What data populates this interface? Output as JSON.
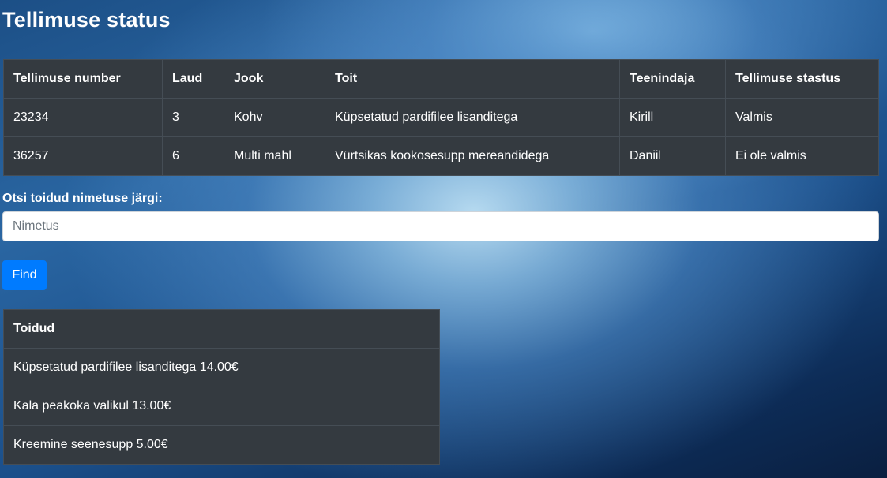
{
  "page": {
    "title": "Tellimuse status"
  },
  "orders": {
    "headers": [
      "Tellimuse number",
      "Laud",
      "Jook",
      "Toit",
      "Teenindaja",
      "Tellimuse stastus"
    ],
    "rows": [
      [
        "23234",
        "3",
        "Kohv",
        "Küpsetatud pardifilee lisanditega",
        "Kirill",
        "Valmis"
      ],
      [
        "36257",
        "6",
        "Multi mahl",
        "Vürtsikas kookosesupp mereandidega",
        "Daniil",
        "Ei ole valmis"
      ]
    ]
  },
  "search": {
    "label": "Otsi toidud nimetuse järgi:",
    "placeholder": "Nimetus",
    "value": "",
    "button_label": "Find"
  },
  "foods": {
    "header": "Toidud",
    "items": [
      "Küpsetatud pardifilee lisanditega 14.00€",
      "Kala peakoka valikul 13.00€",
      "Kreemine seenesupp 5.00€"
    ]
  }
}
